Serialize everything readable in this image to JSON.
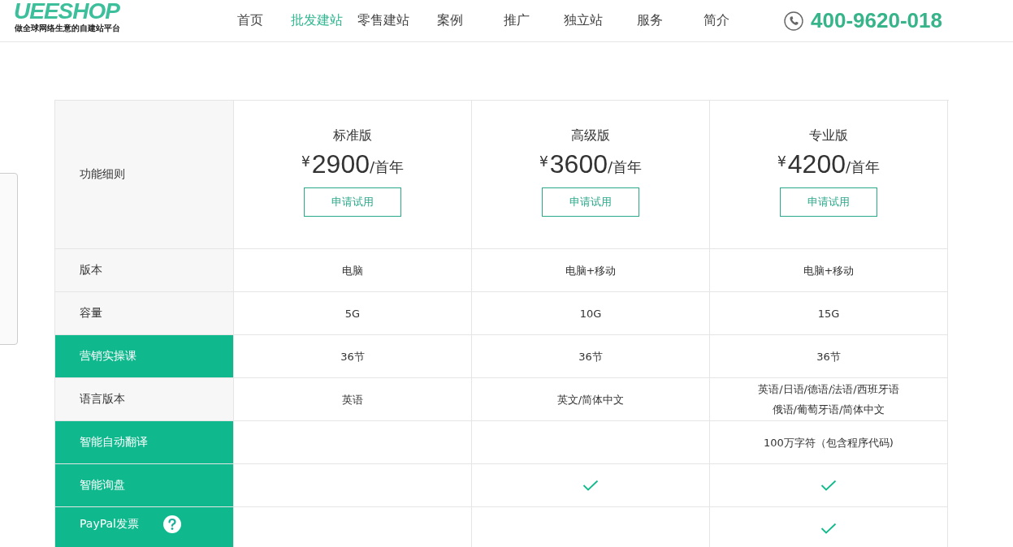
{
  "logo": {
    "name": "UEESHOP",
    "tagline": "做全球网络生意的自建站平台"
  },
  "nav": [
    {
      "label": "首页",
      "selected": false
    },
    {
      "label": "批发建站",
      "selected": true
    },
    {
      "label": "零售建站",
      "selected": false
    },
    {
      "label": "案例",
      "selected": false
    },
    {
      "label": "推广",
      "selected": false
    },
    {
      "label": "独立站",
      "selected": false
    },
    {
      "label": "服务",
      "selected": false
    },
    {
      "label": "简介",
      "selected": false
    }
  ],
  "phone": "400-9620-018",
  "pricing": {
    "corner_label": "功能细则",
    "plans": [
      {
        "name": "标准版",
        "currency": "¥",
        "price": "2900",
        "period": "/首年",
        "button": "申请试用"
      },
      {
        "name": "高级版",
        "currency": "¥",
        "price": "3600",
        "period": "/首年",
        "button": "申请试用"
      },
      {
        "name": "专业版",
        "currency": "¥",
        "price": "4200",
        "period": "/首年",
        "button": "申请试用"
      }
    ],
    "rows": [
      {
        "label": "版本",
        "highlight": false,
        "cells": [
          {
            "kind": "text",
            "lines": [
              "电脑"
            ]
          },
          {
            "kind": "text",
            "lines": [
              "电脑+移动"
            ]
          },
          {
            "kind": "text",
            "lines": [
              "电脑+移动"
            ]
          }
        ]
      },
      {
        "label": "容量",
        "highlight": false,
        "cells": [
          {
            "kind": "text",
            "lines": [
              "5G"
            ]
          },
          {
            "kind": "text",
            "lines": [
              "10G"
            ]
          },
          {
            "kind": "text",
            "lines": [
              "15G"
            ]
          }
        ]
      },
      {
        "label": "营销实操课",
        "highlight": true,
        "cells": [
          {
            "kind": "text",
            "lines": [
              "36节"
            ]
          },
          {
            "kind": "text",
            "lines": [
              "36节"
            ]
          },
          {
            "kind": "text",
            "lines": [
              "36节"
            ]
          }
        ]
      },
      {
        "label": "语言版本",
        "highlight": false,
        "cells": [
          {
            "kind": "text",
            "lines": [
              "英语"
            ]
          },
          {
            "kind": "text",
            "lines": [
              "英文/简体中文"
            ]
          },
          {
            "kind": "text",
            "lines": [
              "英语/日语/德语/法语/西班牙语",
              "俄语/葡萄牙语/简体中文"
            ]
          }
        ]
      },
      {
        "label": "智能自动翻译",
        "highlight": true,
        "cells": [
          {
            "kind": "empty"
          },
          {
            "kind": "empty"
          },
          {
            "kind": "text",
            "lines": [
              "100万字符（包含程序代码)"
            ]
          }
        ]
      },
      {
        "label": "智能询盘",
        "highlight": true,
        "cells": [
          {
            "kind": "empty"
          },
          {
            "kind": "check"
          },
          {
            "kind": "check"
          }
        ]
      },
      {
        "label": "PayPal发票",
        "highlight": true,
        "help": true,
        "cells": [
          {
            "kind": "empty"
          },
          {
            "kind": "empty"
          },
          {
            "kind": "check"
          }
        ]
      }
    ]
  }
}
